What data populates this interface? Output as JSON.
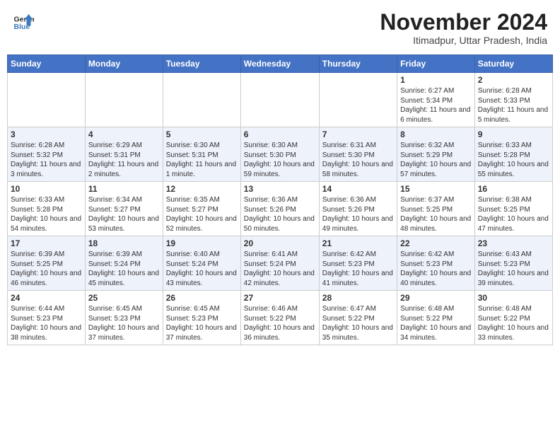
{
  "header": {
    "logo_general": "General",
    "logo_blue": "Blue",
    "month_title": "November 2024",
    "subtitle": "Itimadpur, Uttar Pradesh, India"
  },
  "days_of_week": [
    "Sunday",
    "Monday",
    "Tuesday",
    "Wednesday",
    "Thursday",
    "Friday",
    "Saturday"
  ],
  "weeks": [
    [
      {
        "day": "",
        "text": ""
      },
      {
        "day": "",
        "text": ""
      },
      {
        "day": "",
        "text": ""
      },
      {
        "day": "",
        "text": ""
      },
      {
        "day": "",
        "text": ""
      },
      {
        "day": "1",
        "text": "Sunrise: 6:27 AM\nSunset: 5:34 PM\nDaylight: 11 hours and 6 minutes."
      },
      {
        "day": "2",
        "text": "Sunrise: 6:28 AM\nSunset: 5:33 PM\nDaylight: 11 hours and 5 minutes."
      }
    ],
    [
      {
        "day": "3",
        "text": "Sunrise: 6:28 AM\nSunset: 5:32 PM\nDaylight: 11 hours and 3 minutes."
      },
      {
        "day": "4",
        "text": "Sunrise: 6:29 AM\nSunset: 5:31 PM\nDaylight: 11 hours and 2 minutes."
      },
      {
        "day": "5",
        "text": "Sunrise: 6:30 AM\nSunset: 5:31 PM\nDaylight: 11 hours and 1 minute."
      },
      {
        "day": "6",
        "text": "Sunrise: 6:30 AM\nSunset: 5:30 PM\nDaylight: 10 hours and 59 minutes."
      },
      {
        "day": "7",
        "text": "Sunrise: 6:31 AM\nSunset: 5:30 PM\nDaylight: 10 hours and 58 minutes."
      },
      {
        "day": "8",
        "text": "Sunrise: 6:32 AM\nSunset: 5:29 PM\nDaylight: 10 hours and 57 minutes."
      },
      {
        "day": "9",
        "text": "Sunrise: 6:33 AM\nSunset: 5:28 PM\nDaylight: 10 hours and 55 minutes."
      }
    ],
    [
      {
        "day": "10",
        "text": "Sunrise: 6:33 AM\nSunset: 5:28 PM\nDaylight: 10 hours and 54 minutes."
      },
      {
        "day": "11",
        "text": "Sunrise: 6:34 AM\nSunset: 5:27 PM\nDaylight: 10 hours and 53 minutes."
      },
      {
        "day": "12",
        "text": "Sunrise: 6:35 AM\nSunset: 5:27 PM\nDaylight: 10 hours and 52 minutes."
      },
      {
        "day": "13",
        "text": "Sunrise: 6:36 AM\nSunset: 5:26 PM\nDaylight: 10 hours and 50 minutes."
      },
      {
        "day": "14",
        "text": "Sunrise: 6:36 AM\nSunset: 5:26 PM\nDaylight: 10 hours and 49 minutes."
      },
      {
        "day": "15",
        "text": "Sunrise: 6:37 AM\nSunset: 5:25 PM\nDaylight: 10 hours and 48 minutes."
      },
      {
        "day": "16",
        "text": "Sunrise: 6:38 AM\nSunset: 5:25 PM\nDaylight: 10 hours and 47 minutes."
      }
    ],
    [
      {
        "day": "17",
        "text": "Sunrise: 6:39 AM\nSunset: 5:25 PM\nDaylight: 10 hours and 46 minutes."
      },
      {
        "day": "18",
        "text": "Sunrise: 6:39 AM\nSunset: 5:24 PM\nDaylight: 10 hours and 45 minutes."
      },
      {
        "day": "19",
        "text": "Sunrise: 6:40 AM\nSunset: 5:24 PM\nDaylight: 10 hours and 43 minutes."
      },
      {
        "day": "20",
        "text": "Sunrise: 6:41 AM\nSunset: 5:24 PM\nDaylight: 10 hours and 42 minutes."
      },
      {
        "day": "21",
        "text": "Sunrise: 6:42 AM\nSunset: 5:23 PM\nDaylight: 10 hours and 41 minutes."
      },
      {
        "day": "22",
        "text": "Sunrise: 6:42 AM\nSunset: 5:23 PM\nDaylight: 10 hours and 40 minutes."
      },
      {
        "day": "23",
        "text": "Sunrise: 6:43 AM\nSunset: 5:23 PM\nDaylight: 10 hours and 39 minutes."
      }
    ],
    [
      {
        "day": "24",
        "text": "Sunrise: 6:44 AM\nSunset: 5:23 PM\nDaylight: 10 hours and 38 minutes."
      },
      {
        "day": "25",
        "text": "Sunrise: 6:45 AM\nSunset: 5:23 PM\nDaylight: 10 hours and 37 minutes."
      },
      {
        "day": "26",
        "text": "Sunrise: 6:45 AM\nSunset: 5:23 PM\nDaylight: 10 hours and 37 minutes."
      },
      {
        "day": "27",
        "text": "Sunrise: 6:46 AM\nSunset: 5:22 PM\nDaylight: 10 hours and 36 minutes."
      },
      {
        "day": "28",
        "text": "Sunrise: 6:47 AM\nSunset: 5:22 PM\nDaylight: 10 hours and 35 minutes."
      },
      {
        "day": "29",
        "text": "Sunrise: 6:48 AM\nSunset: 5:22 PM\nDaylight: 10 hours and 34 minutes."
      },
      {
        "day": "30",
        "text": "Sunrise: 6:48 AM\nSunset: 5:22 PM\nDaylight: 10 hours and 33 minutes."
      }
    ]
  ]
}
